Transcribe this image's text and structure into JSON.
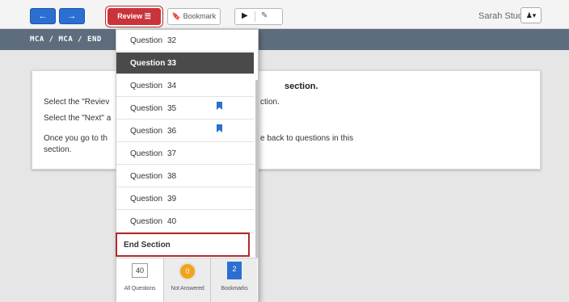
{
  "toolbar": {
    "prev_icon": "←",
    "next_icon": "→",
    "review_label": "Review ☰",
    "bookmark_label": "🔖 Bookmark",
    "pointer_icon": "▶",
    "scratch_icon": "✎",
    "user_name": "Sarah Student",
    "user_menu_label": "♟▾"
  },
  "breadcrumb": "MCA / MCA / END",
  "card": {
    "title": "section.",
    "line1_start": "Select the \"Reviev",
    "line1_end": "ction.",
    "line2_start": "Select the \"Next\" a",
    "line3_start": "Once you go to th",
    "line3_end": "e back to questions in this",
    "line4": "section."
  },
  "review_panel": {
    "questions": [
      {
        "label": "Question",
        "number": "32",
        "selected": false,
        "bookmarked": false
      },
      {
        "label": "Question",
        "number": "33",
        "selected": true,
        "bookmarked": false
      },
      {
        "label": "Question",
        "number": "34",
        "selected": false,
        "bookmarked": false
      },
      {
        "label": "Question",
        "number": "35",
        "selected": false,
        "bookmarked": true
      },
      {
        "label": "Question",
        "number": "36",
        "selected": false,
        "bookmarked": true
      },
      {
        "label": "Question",
        "number": "37",
        "selected": false,
        "bookmarked": false
      },
      {
        "label": "Question",
        "number": "38",
        "selected": false,
        "bookmarked": false
      },
      {
        "label": "Question",
        "number": "39",
        "selected": false,
        "bookmarked": false
      },
      {
        "label": "Question",
        "number": "40",
        "selected": false,
        "bookmarked": false
      }
    ],
    "end_section_label": "End Section",
    "tabs": {
      "all": {
        "count": "40",
        "label": "All Questions"
      },
      "not_answered": {
        "count": "0",
        "label": "Not Answered"
      },
      "bookmarks": {
        "count": "2",
        "label": "Bookmarks"
      }
    }
  },
  "colors": {
    "accent_blue": "#2a6fd1",
    "highlight_red": "#b52a2a",
    "selected_row": "#4a4a4a",
    "breadcrumb_bar": "#5d6d7e",
    "not_answered_orange": "#f3a31a"
  }
}
